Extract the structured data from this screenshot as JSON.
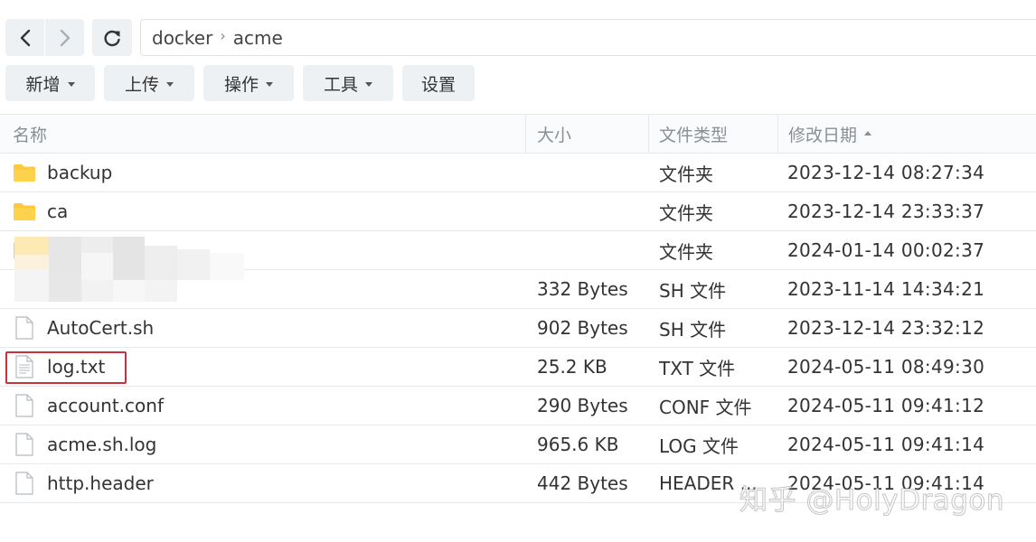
{
  "nav": {
    "back_icon": "chevron-left-icon",
    "forward_icon": "chevron-right-icon",
    "refresh_icon": "refresh-icon"
  },
  "breadcrumb": {
    "items": [
      "docker",
      "acme"
    ],
    "separator": "›"
  },
  "toolbar": {
    "new_label": "新增",
    "upload_label": "上传",
    "action_label": "操作",
    "tools_label": "工具",
    "settings_label": "设置"
  },
  "table": {
    "columns": {
      "name": "名称",
      "size": "大小",
      "type": "文件类型",
      "modified": "修改日期"
    },
    "sort": "修改日期 ascending",
    "rows": [
      {
        "icon": "folder-icon",
        "name": "backup",
        "size": "",
        "type": "文件夹",
        "modified": "2023-12-14 08:27:34"
      },
      {
        "icon": "folder-icon",
        "name": "ca",
        "size": "",
        "type": "文件夹",
        "modified": "2023-12-14 23:33:37"
      },
      {
        "icon": "folder-icon",
        "name": "",
        "size": "",
        "type": "文件夹",
        "modified": "2024-01-14 00:02:37"
      },
      {
        "icon": "file-icon",
        "name": "",
        "size": "332 Bytes",
        "type": "SH 文件",
        "modified": "2023-11-14 14:34:21"
      },
      {
        "icon": "file-icon",
        "name": "AutoCert.sh",
        "size": "902 Bytes",
        "type": "SH 文件",
        "modified": "2023-12-14 23:32:12"
      },
      {
        "icon": "text-file-icon",
        "name": "log.txt",
        "size": "25.2 KB",
        "type": "TXT 文件",
        "modified": "2024-05-11 08:49:30"
      },
      {
        "icon": "file-icon",
        "name": "account.conf",
        "size": "290 Bytes",
        "type": "CONF 文件",
        "modified": "2024-05-11 09:41:12"
      },
      {
        "icon": "file-icon",
        "name": "acme.sh.log",
        "size": "965.6 KB",
        "type": "LOG 文件",
        "modified": "2024-05-11 09:41:14"
      },
      {
        "icon": "file-icon",
        "name": "http.header",
        "size": "442 Bytes",
        "type": "HEADER ...",
        "modified": "2024-05-11 09:41:14"
      }
    ]
  },
  "watermark": "知乎 @HolyDragon",
  "colors": {
    "folder": "#ffc93c",
    "highlight": "#c8323a",
    "button_bg": "#eef1f4"
  }
}
